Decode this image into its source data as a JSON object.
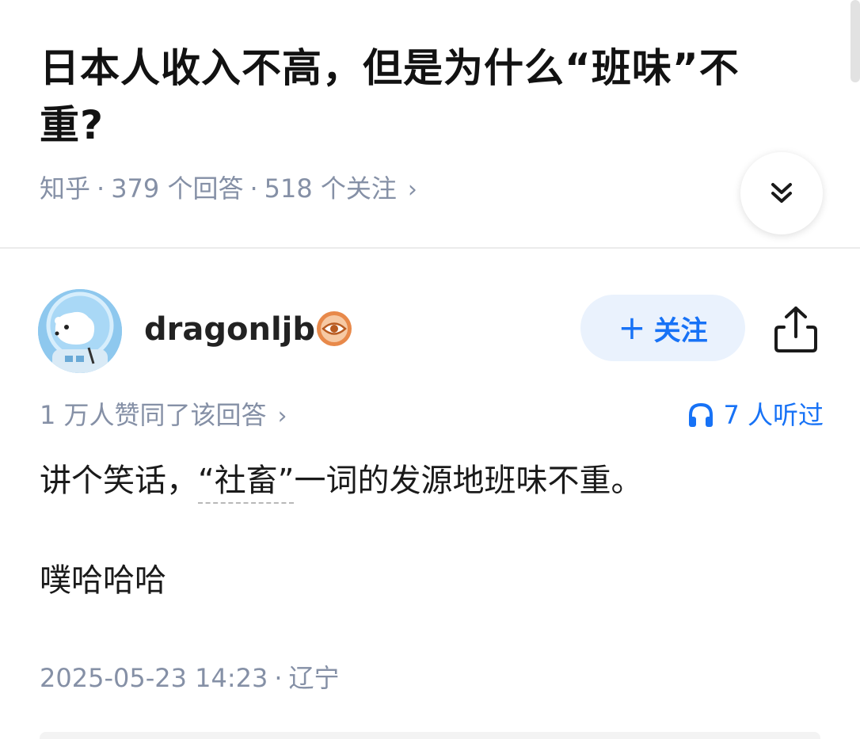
{
  "question": {
    "title": "日本人收入不高，但是为什么“班味”不重?",
    "source": "知乎",
    "separator": "·",
    "answers_count": "379 个回答",
    "followers_count": "518 个关注",
    "more_chevron": "›"
  },
  "collapse_button": {
    "icon": "chevron-double-down-icon"
  },
  "author": {
    "name": "dragonljb",
    "avatar_icon": "polar-bear-astronaut-avatar",
    "badge_icon": "eye-badge-icon",
    "badge_color": "#e8894a"
  },
  "follow_button": {
    "plus": "+",
    "label": "关注",
    "color": "#1772f6",
    "background": "#eaf2fd"
  },
  "share_button": {
    "icon": "share-icon"
  },
  "stats": {
    "likes": "1 万人赞同了该回答",
    "likes_chevron": "›",
    "listens": "7 人听过",
    "listens_icon": "headphones-icon"
  },
  "answer": {
    "p1_before": "讲个笑话，",
    "p1_link": "“社畜”",
    "p1_after": "一词的发源地班味不重。",
    "p2": "噗哈哈哈"
  },
  "footer": {
    "datetime": "2025-05-23 14:23",
    "separator": "·",
    "location": "辽宁"
  },
  "colors": {
    "accent": "#1772f6",
    "meta_text": "#8590a6"
  }
}
